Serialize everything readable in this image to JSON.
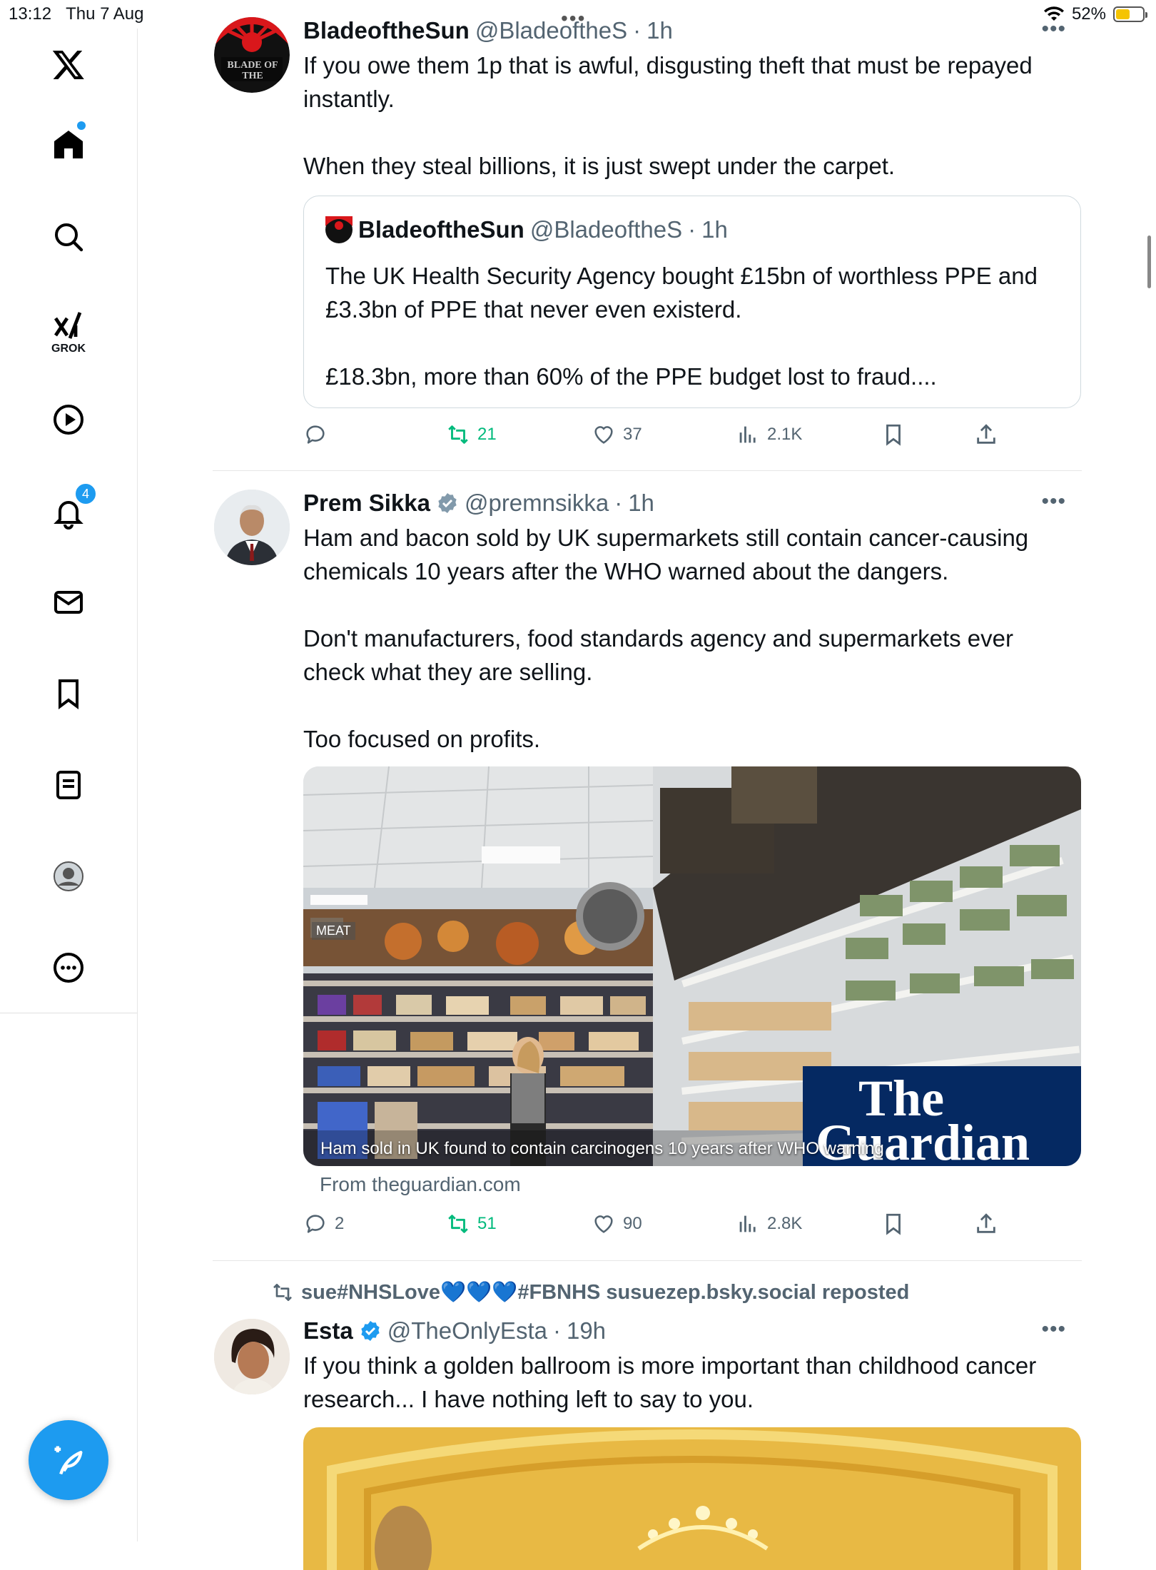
{
  "status_bar": {
    "time": "13:12",
    "date": "Thu 7 Aug",
    "battery": "52%",
    "battery_level": 0.52
  },
  "sidebar": {
    "items": [
      {
        "name": "x-logo"
      },
      {
        "name": "home"
      },
      {
        "name": "search"
      },
      {
        "name": "grok",
        "label": "GROK"
      },
      {
        "name": "video"
      },
      {
        "name": "notifications",
        "badge": "4"
      },
      {
        "name": "messages"
      },
      {
        "name": "bookmarks"
      },
      {
        "name": "lists"
      },
      {
        "name": "profile"
      },
      {
        "name": "more"
      }
    ]
  },
  "tweets": [
    {
      "name": "BladeoftheSun",
      "handle": "@BladeoftheS",
      "time": "1h",
      "avatar_text": "BLADE OF THE",
      "text": "If you owe them 1p that is awful, disgusting theft that must be repayed instantly.\n\nWhen they steal billions, it is just swept under the carpet.",
      "quote": {
        "name": "BladeoftheSun",
        "handle": "@BladeoftheS",
        "time": "1h",
        "text": "The UK Health Security Agency bought £15bn of worthless PPE and £3.3bn of PPE that never even existerd.\n\n£18.3bn, more than 60% of the PPE budget lost to fraud...."
      },
      "stats": {
        "replies": "",
        "reposts": "21",
        "likes": "37",
        "views": "2.1K"
      }
    },
    {
      "name": "Prem Sikka",
      "handle": "@premnsikka",
      "time": "1h",
      "text": "Ham and bacon sold by UK supermarkets still contain cancer-causing chemicals 10 years after the WHO warned about the dangers.\n\nDon't manufacturers, food standards agency and supermarkets ever check what they are selling.\n\nToo focused on profits.",
      "card": {
        "caption": "Ham sold in UK found to contain carcinogens 10 years after WHO warning",
        "from": "From theguardian.com",
        "logo_line1": "The",
        "logo_line2": "Guardian",
        "shelf_sign": "MEAT"
      },
      "stats": {
        "replies": "2",
        "reposts": "51",
        "likes": "90",
        "views": "2.8K"
      }
    },
    {
      "repost_by_pre": "sue#NHSLove",
      "repost_hearts": "💙💙💙",
      "repost_by_post": "#FBNHS susuezep.bsky.social reposted",
      "name": "Esta",
      "handle": "@TheOnlyEsta",
      "time": "19h",
      "text": "If you think a golden ballroom is more important than childhood cancer research... I have nothing left to say to you."
    }
  ],
  "colors": {
    "accent": "#1d9bf0",
    "repost": "#00ba7c",
    "muted": "#536471",
    "guardian": "#052962"
  }
}
